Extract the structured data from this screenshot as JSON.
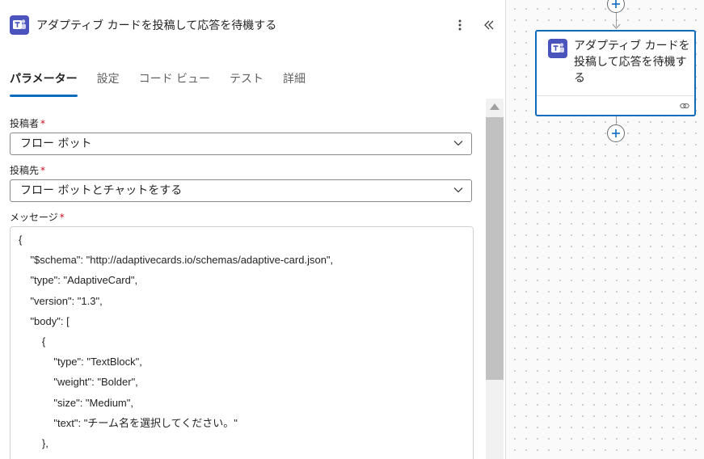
{
  "panel": {
    "title": "アダプティブ カードを投稿して応答を待機する",
    "app_icon": "teams-icon",
    "more_icon": "more-vertical-icon",
    "collapse_icon": "double-chevron-left-icon"
  },
  "tabs": [
    {
      "label": "パラメーター",
      "active": true
    },
    {
      "label": "設定",
      "active": false
    },
    {
      "label": "コード ビュー",
      "active": false
    },
    {
      "label": "テスト",
      "active": false
    },
    {
      "label": "詳細",
      "active": false
    }
  ],
  "fields": {
    "poster": {
      "label": "投稿者",
      "required_mark": "*",
      "value": "フロー ボット"
    },
    "post_in": {
      "label": "投稿先",
      "required_mark": "*",
      "value": "フロー ボットとチャットをする"
    },
    "message": {
      "label": "メッセージ",
      "required_mark": "*",
      "lines": [
        "{",
        "    \"$schema\": \"http://adaptivecards.io/schemas/adaptive-card.json\",",
        "    \"type\": \"AdaptiveCard\",",
        "    \"version\": \"1.3\",",
        "    \"body\": [",
        "        {",
        "            \"type\": \"TextBlock\",",
        "            \"weight\": \"Bolder\",",
        "            \"size\": \"Medium\",",
        "            \"text\": \"チーム名を選択してください。\"",
        "        },"
      ]
    }
  },
  "canvas": {
    "node_title": "アダプティブ カードを投稿して応答を待機する",
    "node_icon": "teams-icon",
    "footer_icon": "link-icon",
    "add_icon": "plus-icon"
  },
  "colors": {
    "accent": "#0f6cbd",
    "teams": "#4b53bc",
    "required": "#c50f1f"
  }
}
